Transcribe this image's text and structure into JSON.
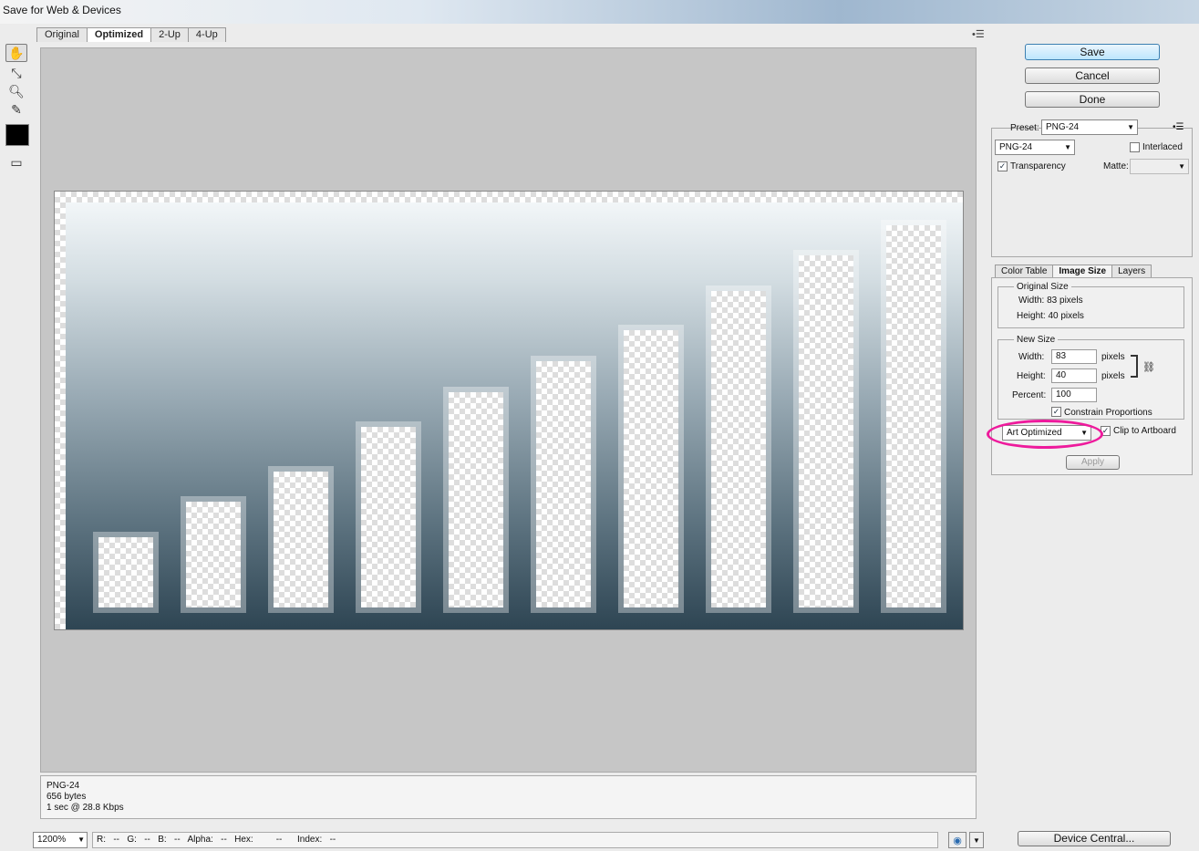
{
  "window": {
    "title": "Save for Web & Devices"
  },
  "view_tabs": [
    {
      "label": "Original"
    },
    {
      "label": "Optimized"
    },
    {
      "label": "2-Up"
    },
    {
      "label": "4-Up"
    }
  ],
  "info": {
    "format": "PNG-24",
    "size": "656 bytes",
    "speed": "1 sec @ 28.8 Kbps"
  },
  "status": {
    "zoom": "1200%",
    "readout": "R:   --   G:   --   B:   --   Alpha:   --   Hex:         --      Index:   --"
  },
  "buttons": {
    "save": "Save",
    "cancel": "Cancel",
    "done": "Done",
    "device_central": "Device Central..."
  },
  "settings": {
    "preset_label": "Preset:",
    "preset_value": "PNG-24",
    "format_value": "PNG-24",
    "interlaced_label": "Interlaced",
    "interlaced_checked": false,
    "transparency_label": "Transparency",
    "transparency_checked": true,
    "matte_label": "Matte:"
  },
  "panel_tabs": [
    {
      "label": "Color Table"
    },
    {
      "label": "Image Size"
    },
    {
      "label": "Layers"
    }
  ],
  "image_size": {
    "original_title": "Original Size",
    "original_width": "Width: 83 pixels",
    "original_height": "Height: 40 pixels",
    "new_title": "New Size",
    "width_label": "Width:",
    "width_value": "83",
    "height_label": "Height:",
    "height_value": "40",
    "unit": "pixels",
    "percent_label": "Percent:",
    "percent_value": "100",
    "constrain_label": "Constrain Proportions",
    "quality_value": "Art Optimized",
    "clip_label": "Clip to Artboard",
    "apply": "Apply"
  },
  "colors": {
    "highlight": "#ee1a9c",
    "primary_button": "#bde6fd"
  },
  "preview_bars": [
    0.16,
    0.24,
    0.31,
    0.41,
    0.49,
    0.56,
    0.63,
    0.72,
    0.8,
    0.87
  ],
  "icons": [
    "hand-icon",
    "slice-select-icon",
    "zoom-icon",
    "eyedropper-icon",
    "color-swatch-icon",
    "toggle-slices-icon",
    "panel-menu-icon",
    "browser-preview-icon",
    "chain-link-icon"
  ]
}
